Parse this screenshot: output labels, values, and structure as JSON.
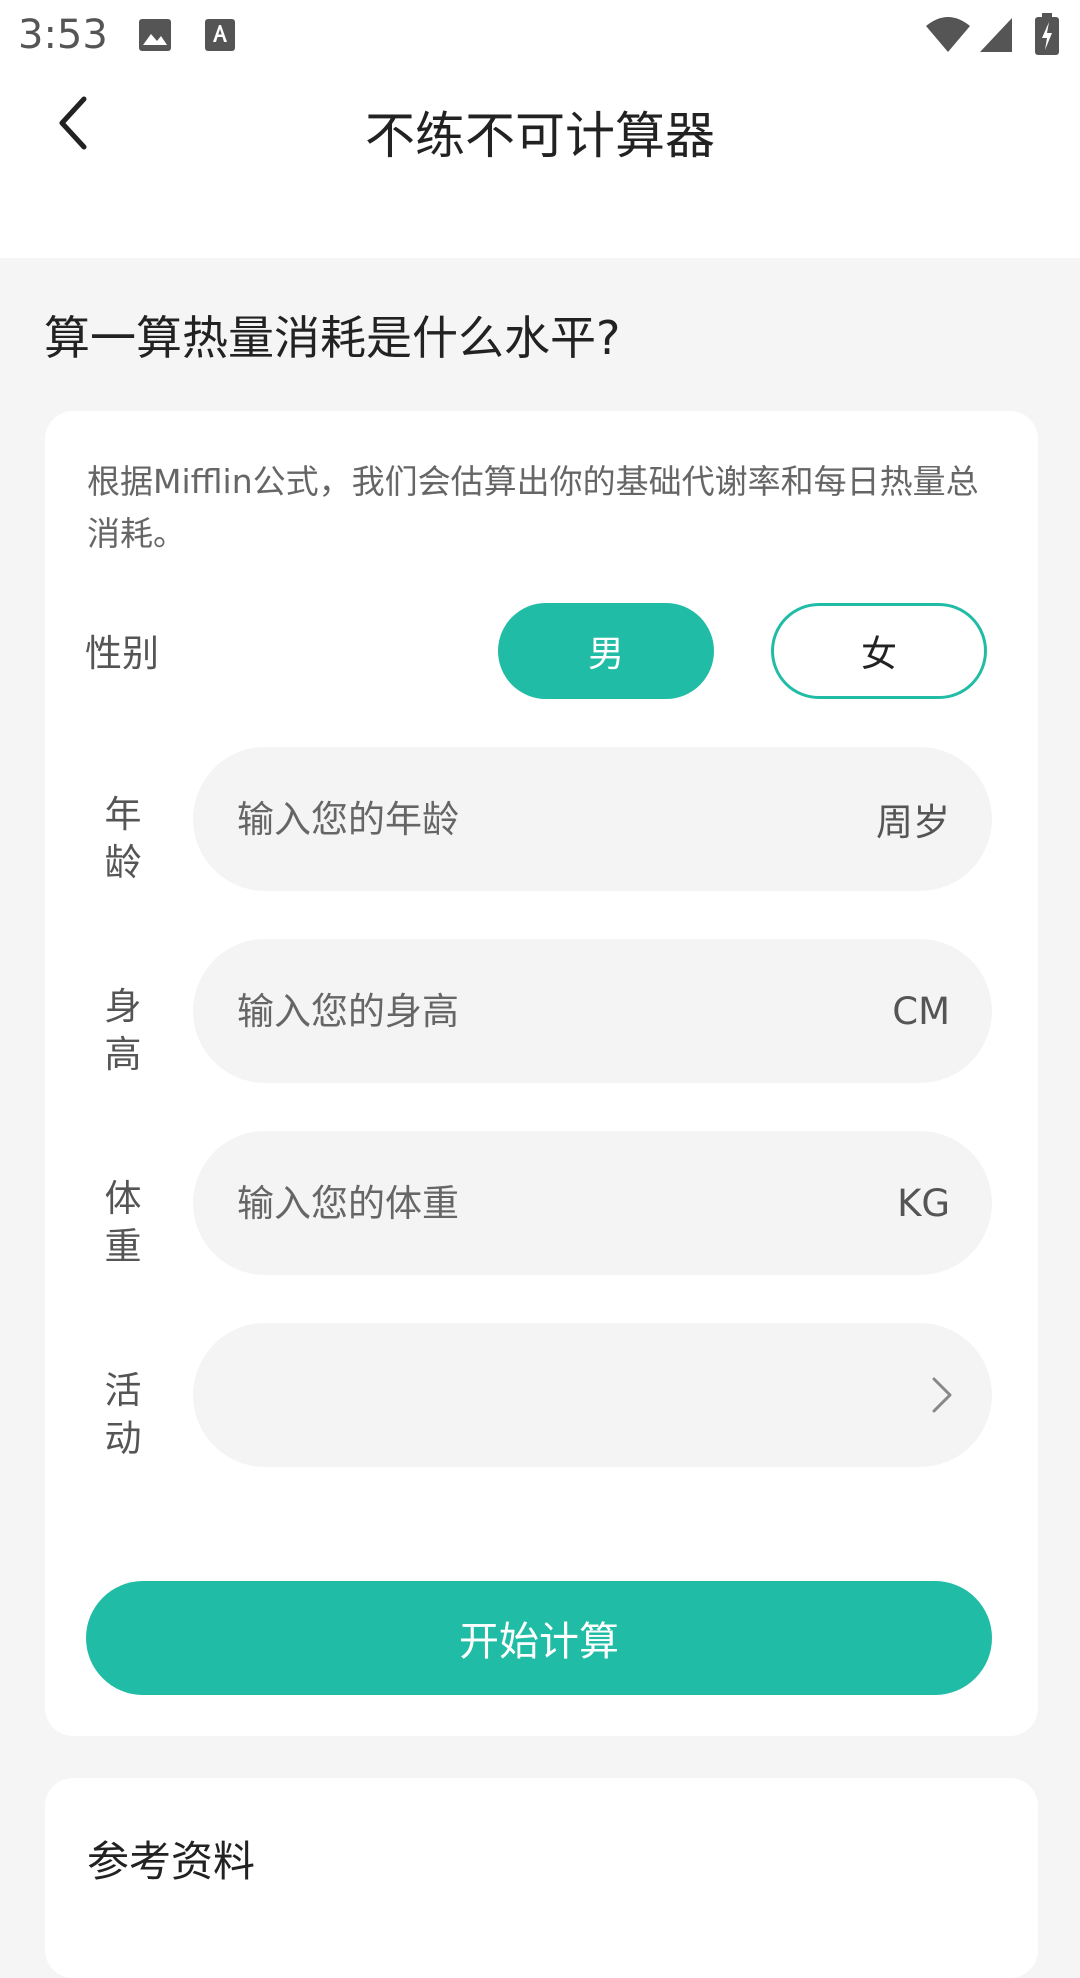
{
  "status_bar": {
    "time": "3:53"
  },
  "header": {
    "title": "不练不可计算器"
  },
  "heading": "算一算热量消耗是什么水平?",
  "form": {
    "description": "根据Mifflin公式，我们会估算出你的基础代谢率和每日热量总消耗。",
    "gender_label": "性别",
    "gender_options": [
      "男",
      "女"
    ],
    "gender_selected": "男",
    "age": {
      "label": "年龄",
      "placeholder": "输入您的年龄",
      "unit": "周岁"
    },
    "height": {
      "label": "身高",
      "placeholder": "输入您的身高",
      "unit": "CM"
    },
    "weight": {
      "label": "体重",
      "placeholder": "输入您的体重",
      "unit": "KG"
    },
    "activity": {
      "label": "活动",
      "value": ""
    },
    "submit_label": "开始计算"
  },
  "reference": {
    "title": "参考资料"
  },
  "colors": {
    "accent": "#21bca5",
    "background": "#f5f5f5"
  },
  "icons": [
    "image-icon",
    "text-icon",
    "wifi-icon",
    "signal-icon",
    "battery-charging-icon",
    "back-arrow-icon",
    "chevron-right-icon"
  ]
}
